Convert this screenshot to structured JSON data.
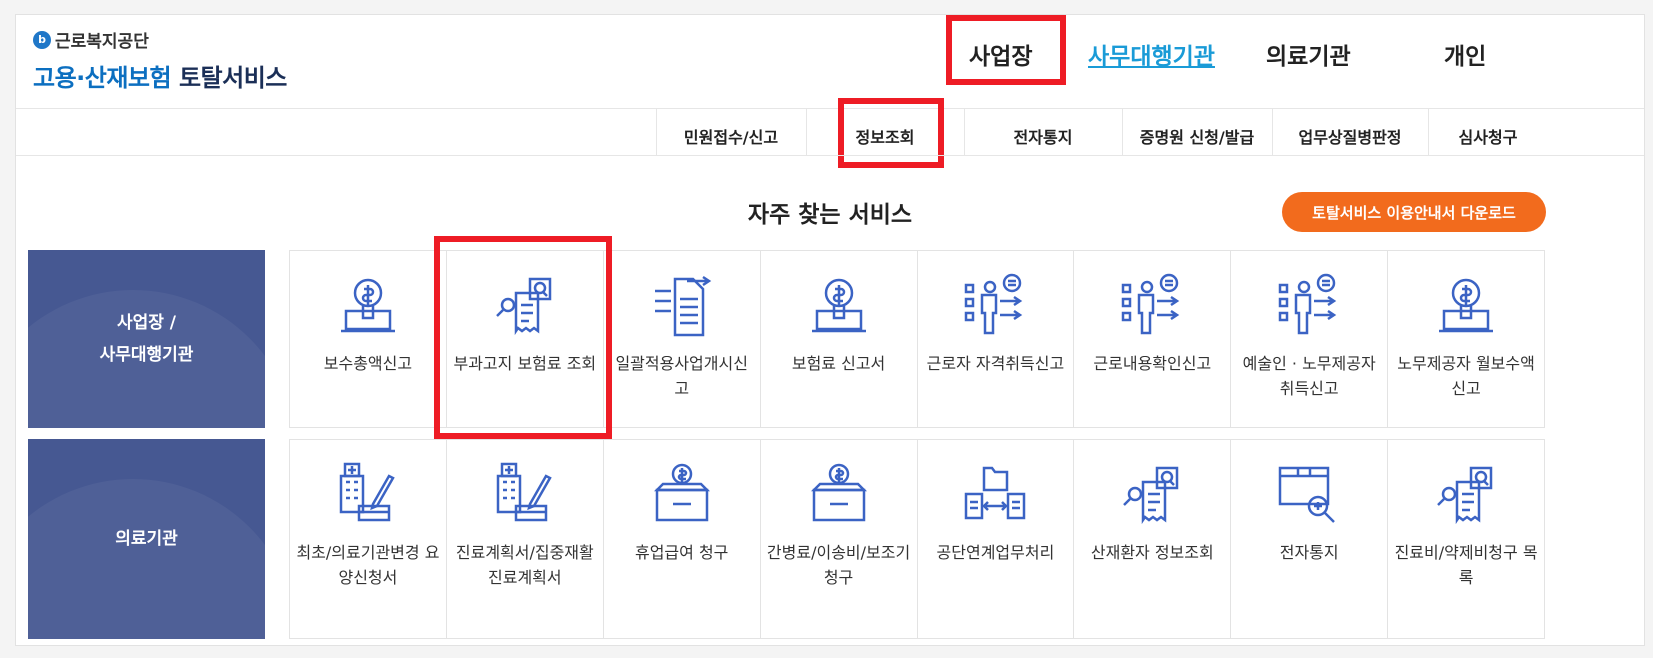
{
  "header": {
    "logo_org": "근로복지공단",
    "logo_title_blue": "고용·산재보험",
    "logo_title_dark": "토탈서비스",
    "top_nav": [
      "사업장",
      "사무대행기관",
      "의료기관",
      "개인"
    ]
  },
  "sub_nav": [
    "민원접수/신고",
    "정보조회",
    "전자통지",
    "증명원 신청/발급",
    "업무상질병판정",
    "심사청구"
  ],
  "main": {
    "section_title": "자주 찾는 서비스",
    "download_button": "토탈서비스 이용안내서 다운로드",
    "categories": [
      {
        "label_line1": "사업장 /",
        "label_line2": "사무대행기관",
        "items": [
          {
            "label": "보수총액신고",
            "icon": "money-lightbulb-laptop-icon"
          },
          {
            "label": "부과고지 보험료 조회",
            "icon": "document-search-icon"
          },
          {
            "label": "일괄적용사업개시신고",
            "icon": "document-list-arrows-icon"
          },
          {
            "label": "보험료 신고서",
            "icon": "money-lightbulb-laptop-icon"
          },
          {
            "label": "근로자 자격취득신고",
            "icon": "person-checklist-icon"
          },
          {
            "label": "근로내용확인신고",
            "icon": "person-checklist-icon"
          },
          {
            "label": "예술인 · 노무제공자 취득신고",
            "icon": "person-checklist-icon"
          },
          {
            "label": "노무제공자 월보수액 신고",
            "icon": "money-lightbulb-laptop-icon"
          }
        ]
      },
      {
        "label_line1": "의료기관",
        "items": [
          {
            "label": "최초/의료기관변경 요양신청서",
            "icon": "hospital-form-icon"
          },
          {
            "label": "진료계획서/집중재활진료계획서",
            "icon": "hospital-form-icon"
          },
          {
            "label": "휴업급여 청구",
            "icon": "money-box-icon"
          },
          {
            "label": "간병료/이송비/보조기 청구",
            "icon": "money-box-icon"
          },
          {
            "label": "공단연계업무처리",
            "icon": "folder-exchange-icon"
          },
          {
            "label": "산재환자 정보조회",
            "icon": "document-search-icon"
          },
          {
            "label": "전자통지",
            "icon": "package-search-icon"
          },
          {
            "label": "진료비/약제비청구 목록",
            "icon": "document-search-icon"
          }
        ]
      }
    ]
  },
  "colors": {
    "brand_blue": "#0c6fc0",
    "link_blue": "#1a9bd7",
    "category_bg": "#465892",
    "orange": "#f26b1d",
    "highlight_red": "#ee1c25",
    "icon_blue": "#3b63c4"
  }
}
